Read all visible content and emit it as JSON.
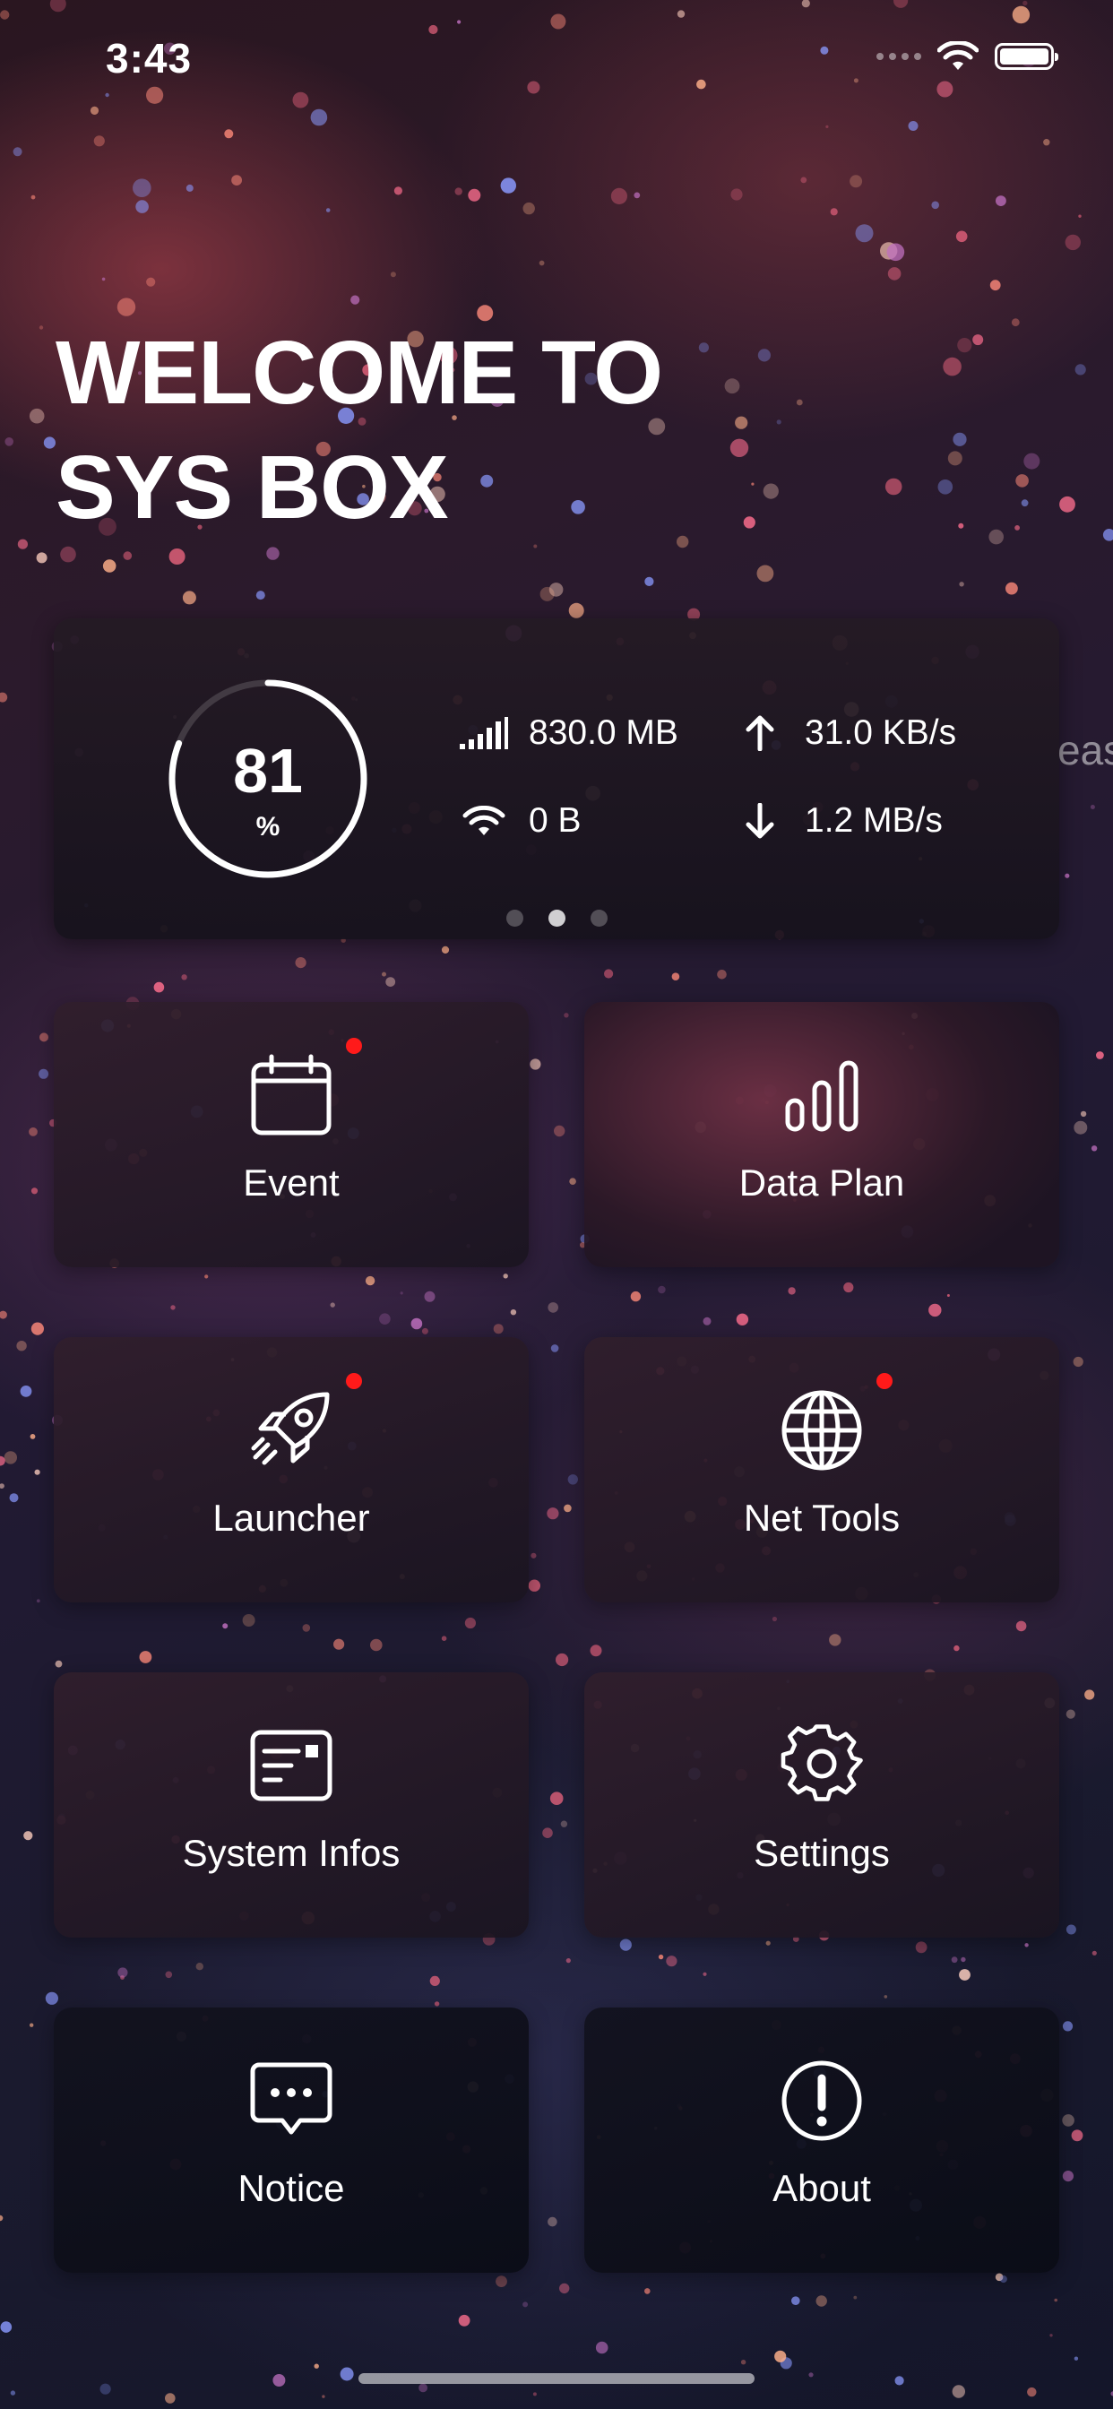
{
  "status_bar": {
    "time": "3:43"
  },
  "welcome": {
    "line1": "WELCOME TO",
    "line2": "SYS BOX"
  },
  "stats_card": {
    "battery_percent": 81,
    "battery_value": "81",
    "battery_unit": "%",
    "cellular_data": "830.0 MB",
    "wifi_data": "0 B",
    "upload_speed": "31.0 KB/s",
    "download_speed": "1.2 MB/s",
    "pages": {
      "count": 3,
      "active_index": 1
    }
  },
  "tiles": [
    {
      "label": "Event",
      "icon": "calendar-icon",
      "badge": true
    },
    {
      "label": "Data Plan",
      "icon": "bar-chart-icon",
      "badge": false
    },
    {
      "label": "Launcher",
      "icon": "rocket-icon",
      "badge": true
    },
    {
      "label": "Net Tools",
      "icon": "globe-icon",
      "badge": true
    },
    {
      "label": "System Infos",
      "icon": "info-card-icon",
      "badge": false
    },
    {
      "label": "Settings",
      "icon": "gear-icon",
      "badge": false
    },
    {
      "label": "Notice",
      "icon": "chat-bubble-icon",
      "badge": false
    },
    {
      "label": "About",
      "icon": "exclamation-icon",
      "badge": false
    }
  ],
  "edge_peek_text": "eas",
  "colors": {
    "badge": "#ff1a1a",
    "text": "#ffffff"
  }
}
